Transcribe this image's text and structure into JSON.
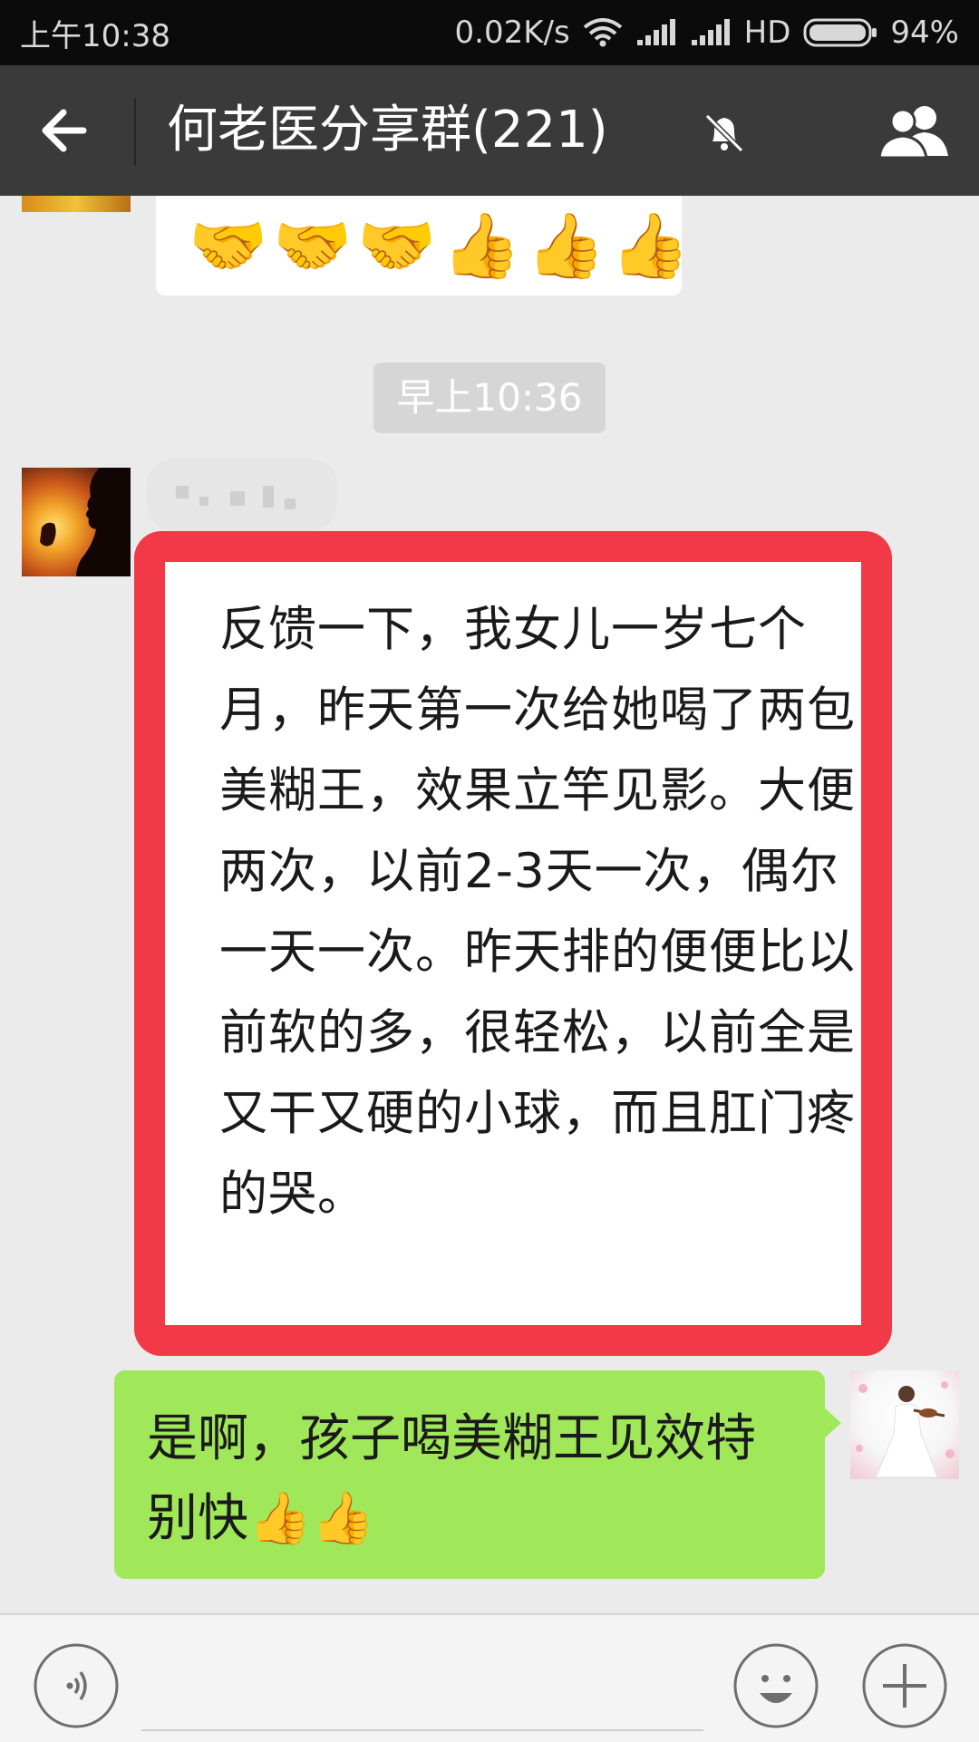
{
  "status_bar": {
    "time": "上午10:38",
    "network_speed": "0.02K/s",
    "network_type": "HD",
    "battery": "94%"
  },
  "header": {
    "title": "何老医分享群(221)",
    "back_icon": "arrow-left-icon",
    "mute_icon": "bell-off-icon",
    "members_icon": "group-members-icon"
  },
  "messages": {
    "prev_emojis": [
      "🤝",
      "🤝",
      "🤝",
      "👍",
      "👍",
      "👍"
    ],
    "timestamp": "早上10:36",
    "incoming_text": "反馈一下，我女儿一岁七个月，昨天第一次给她喝了两包美糊王，效果立竿见影。大便两次，以前2-3天一次，偶尔一天一次。昨天排的便便比以前软的多，很轻松，以前全是又干又硬的小球，而且肛门疼的哭。",
    "highlight_color": "#f23947",
    "outgoing_text": "是啊，孩子喝美糊王见效特别快👍👍",
    "outgoing_bubble_color": "#a0e75a"
  },
  "input_bar": {
    "voice_icon": "voice-icon",
    "emoji_icon": "smiley-icon",
    "more_icon": "plus-icon"
  }
}
